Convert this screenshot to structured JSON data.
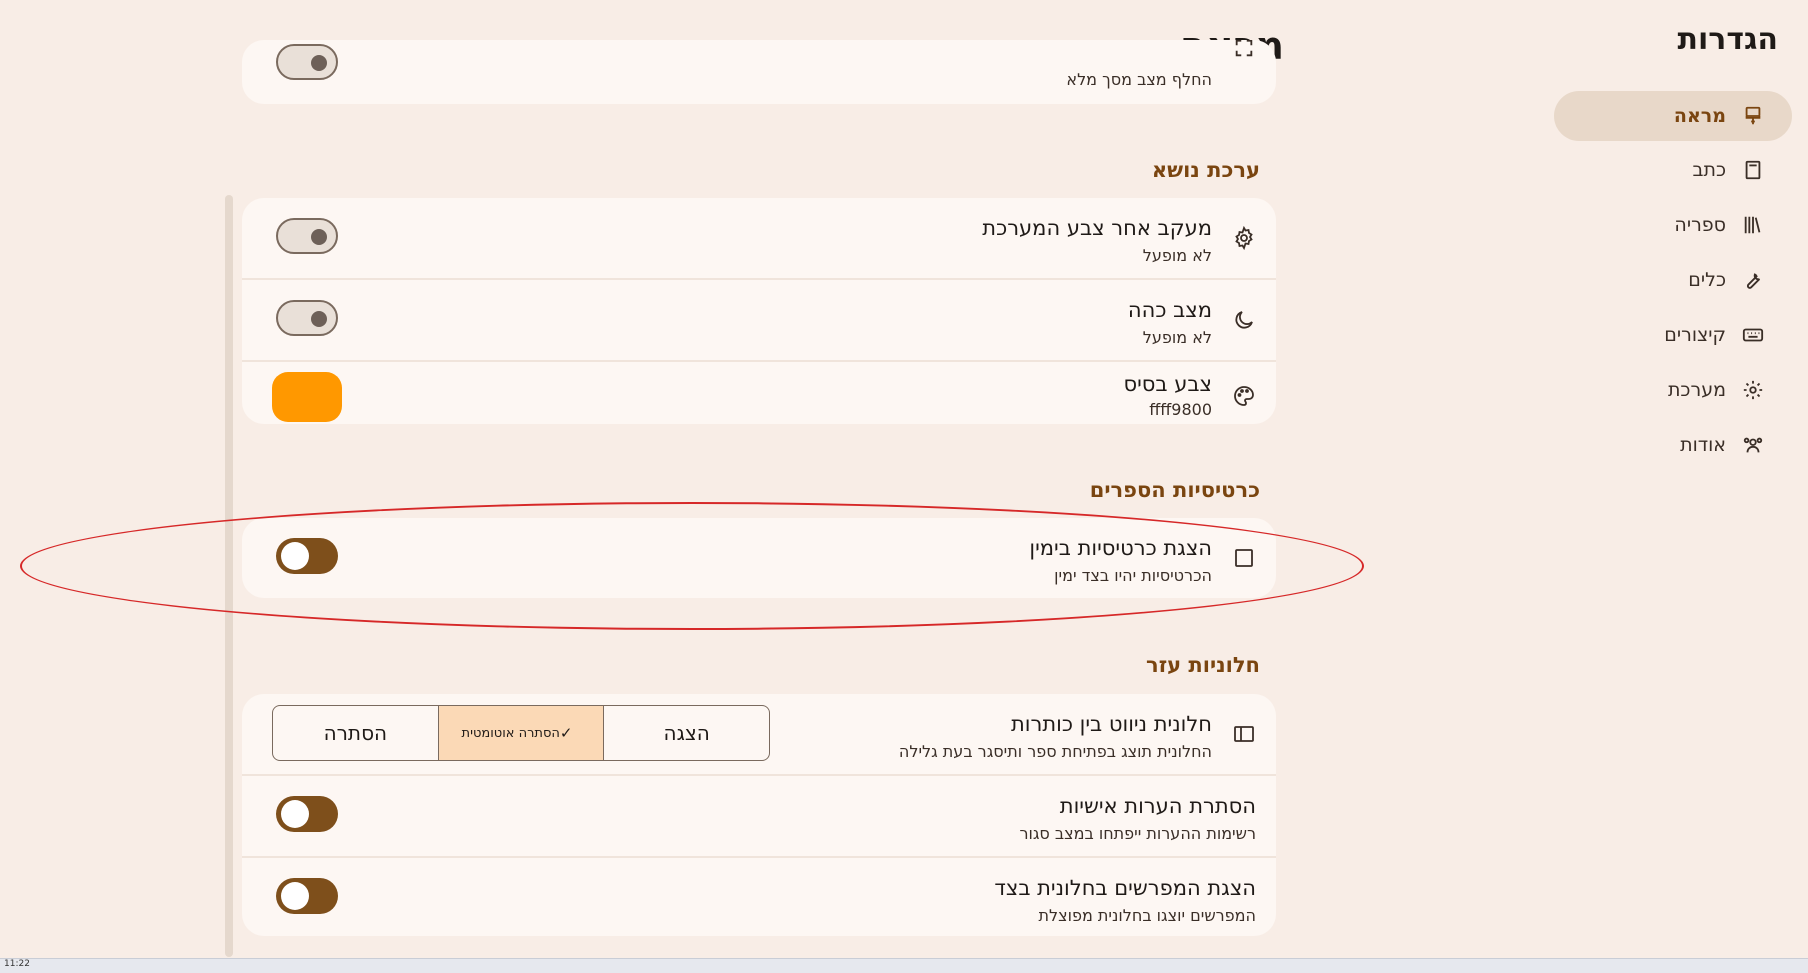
{
  "sidebar": {
    "title": "הגדרות",
    "items": [
      {
        "label": "מראה",
        "icon": "paintbrush-icon"
      },
      {
        "label": "כתב",
        "icon": "book-icon"
      },
      {
        "label": "ספריה",
        "icon": "library-icon"
      },
      {
        "label": "כלים",
        "icon": "wrench-icon"
      },
      {
        "label": "קיצורים",
        "icon": "keyboard-icon"
      },
      {
        "label": "מערכת",
        "icon": "gear-icon"
      },
      {
        "label": "אודות",
        "icon": "people-icon"
      }
    ]
  },
  "main": {
    "title": "מראה",
    "fullscreen_row": {
      "subtitle": "החלף מצב מסך מלא"
    },
    "theme_section": {
      "title": "ערכת נושא",
      "rows": [
        {
          "title": "מעקב אחר צבע המערכת",
          "subtitle": "לא מופעל",
          "icon": "gear-icon",
          "enabled": false
        },
        {
          "title": "מצב כהה",
          "subtitle": "לא מופעל",
          "icon": "moon-icon",
          "enabled": false
        },
        {
          "title": "צבע בסיס",
          "subtitle": "ffff9800",
          "icon": "palette-icon",
          "color": "#ff9800"
        }
      ]
    },
    "tabs_section": {
      "title": "כרטיסיות הספרים",
      "rows": [
        {
          "title": "הצגת כרטיסיות בימין",
          "subtitle": "הכרטיסיות יהיו בצד ימין",
          "icon": "square-icon",
          "enabled": true
        }
      ]
    },
    "panels_section": {
      "title": "חלוניות עזר",
      "nav_row": {
        "title": "חלונית ניווט בין כותרות",
        "subtitle": "החלונית תוצג בפתיחת ספר ותיסגר בעת גלילה",
        "icon": "sidebar-panel-icon",
        "options": [
          "הסתרה",
          "הסתרה אוטומטית",
          "הצגה"
        ],
        "selected": "הסתרה אוטומטית",
        "check": "✓"
      },
      "rows": [
        {
          "title": "הסתרת הערות אישיות",
          "subtitle": "רשימות ההערות ייפתחו במצב סגור",
          "enabled": true
        },
        {
          "title": "הצגת המפרשים בחלונית בצד",
          "subtitle": "המפרשים יוצגו בחלונית מפוצלת",
          "enabled": true
        }
      ]
    }
  },
  "colors": {
    "background": "#f8ede6",
    "card": "#fdf7f3",
    "accent": "#7e4f1b",
    "section_title": "#7a4510",
    "annotation": "#d62828"
  },
  "taskbar": {
    "clock": "11:22"
  }
}
